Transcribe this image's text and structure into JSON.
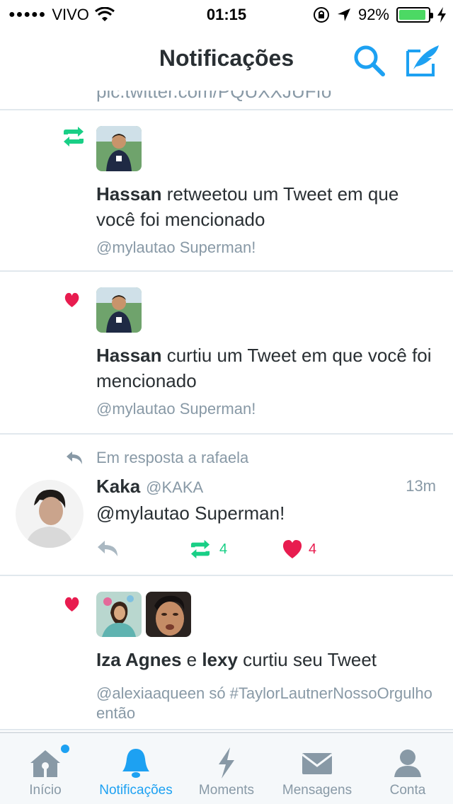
{
  "status_bar": {
    "carrier": "VIVO",
    "time": "01:15",
    "battery": "92%",
    "battery_level": 0.92
  },
  "header": {
    "title": "Notificações"
  },
  "colors": {
    "accent": "#1da1f2",
    "retweet": "#19cf86",
    "like": "#e81c4f",
    "text": "#292f33",
    "muted": "#8899a6"
  },
  "feed": {
    "cut_text": "pic.twitter.com/PQUXXJUFfo",
    "notifications": [
      {
        "type_icon": "retweet-icon",
        "name": "Hassan",
        "text": " retweetou um Tweet em que você foi mencionado",
        "sub": "@mylautao Superman!"
      },
      {
        "type_icon": "heart-icon",
        "name": "Hassan",
        "text": " curtiu um Tweet em que você foi mencionado",
        "sub": "@mylautao Superman!"
      }
    ],
    "tweet": {
      "reply_label": "Em resposta a rafaela",
      "name": "Kaka",
      "handle": "@KAKA",
      "time": "13m",
      "text": "@mylautao Superman!",
      "retweets": "4",
      "likes": "4"
    },
    "group_like": {
      "name1": "Iza Agnes",
      "conj": " e ",
      "name2": "lexy",
      "text": " curtiu seu Tweet",
      "sub": "@alexiaaqueen só #TaylorLautnerNossoOrgulho então"
    }
  },
  "tabs": [
    {
      "label": "Início",
      "icon": "home-icon"
    },
    {
      "label": "Notificações",
      "icon": "bell-icon"
    },
    {
      "label": "Moments",
      "icon": "lightning-icon"
    },
    {
      "label": "Mensagens",
      "icon": "envelope-icon"
    },
    {
      "label": "Conta",
      "icon": "person-icon"
    }
  ]
}
